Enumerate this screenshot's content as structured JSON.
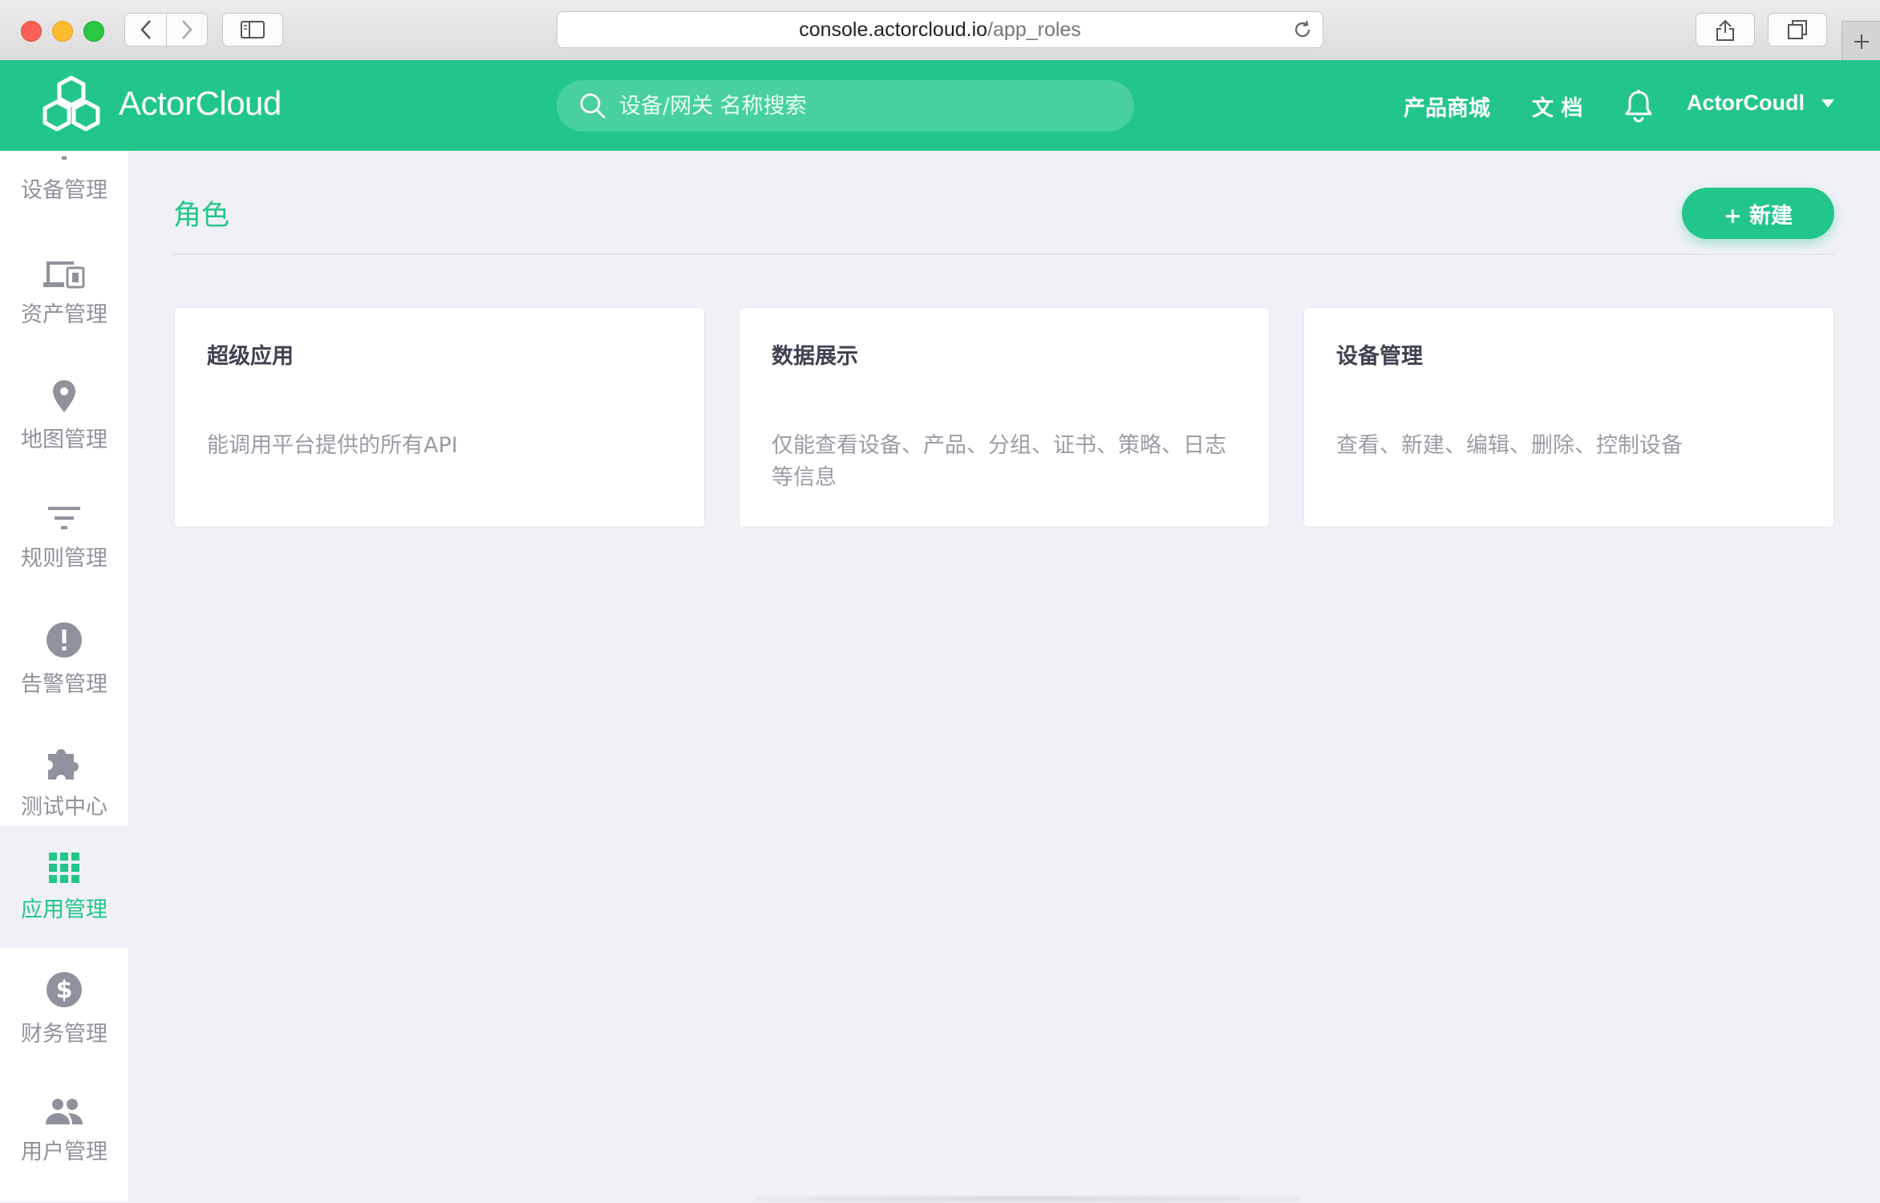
{
  "browser": {
    "url_domain": "console.actorcloud.io",
    "url_path": "/app_roles"
  },
  "header": {
    "logo_text": "ActorCloud",
    "search_placeholder": "设备/网关 名称搜索",
    "links": [
      "产品商城",
      "文 档"
    ],
    "user_name": "ActorCoudl",
    "accent_color": "#22c68a"
  },
  "sidebar": {
    "items": [
      {
        "label": "设备管理",
        "icon": "device-icon",
        "active": false
      },
      {
        "label": "资产管理",
        "icon": "devices-icon",
        "active": false
      },
      {
        "label": "地图管理",
        "icon": "map-pin-icon",
        "active": false
      },
      {
        "label": "规则管理",
        "icon": "filter-icon",
        "active": false
      },
      {
        "label": "告警管理",
        "icon": "alert-icon",
        "active": false
      },
      {
        "label": "测试中心",
        "icon": "puzzle-icon",
        "active": false
      },
      {
        "label": "应用管理",
        "icon": "grid-apps-icon",
        "active": true
      },
      {
        "label": "财务管理",
        "icon": "dollar-icon",
        "active": false
      },
      {
        "label": "用户管理",
        "icon": "users-icon",
        "active": false
      }
    ]
  },
  "main": {
    "title": "角色",
    "new_button": "+ 新建",
    "cards": [
      {
        "title": "超级应用",
        "description": "能调用平台提供的所有API"
      },
      {
        "title": "数据展示",
        "description": "仅能查看设备、产品、分组、证书、策略、日志等信息"
      },
      {
        "title": "设备管理",
        "description": "查看、新建、编辑、删除、控制设备"
      }
    ]
  }
}
